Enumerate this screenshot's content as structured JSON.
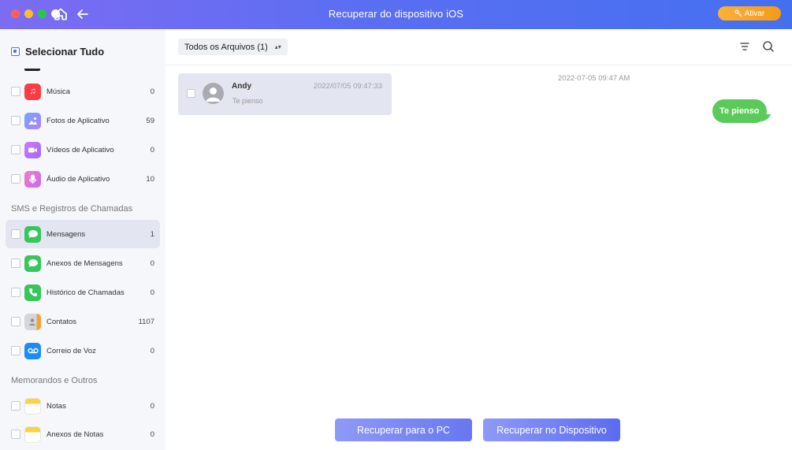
{
  "window": {
    "title": "Recuperar do dispositivo iOS",
    "activate_label": "Ativar",
    "traffic_colors": [
      "#ff5f57",
      "#ffbd2e",
      "#28c840",
      "#ffffff"
    ]
  },
  "sidebar": {
    "select_all": "Selecionar Tudo",
    "sections": [
      "SMS e Registros de Chamadas",
      "Memorandos e Outros"
    ],
    "items": [
      {
        "label": "Música",
        "count": "0",
        "icon": "music-icon",
        "color": "#fc3c44"
      },
      {
        "label": "Fotos de Aplicativo",
        "count": "59",
        "icon": "app-photos-icon",
        "color": "#8b7cf8"
      },
      {
        "label": "Vídeos de Aplicativo",
        "count": "0",
        "icon": "app-video-icon",
        "color": "#b470f5"
      },
      {
        "label": "Áudio de Aplicativo",
        "count": "10",
        "icon": "app-audio-icon",
        "color": "#ec5ab8"
      },
      {
        "label": "Mensagens",
        "count": "1",
        "icon": "messages-icon",
        "color": "#34c759"
      },
      {
        "label": "Anexos de Mensagens",
        "count": "0",
        "icon": "message-attachments-icon",
        "color": "#34c759"
      },
      {
        "label": "Histórico de Chamadas",
        "count": "0",
        "icon": "phone-icon",
        "color": "#34c759"
      },
      {
        "label": "Contatos",
        "count": "1107",
        "icon": "contacts-icon",
        "color": "#c9cbd0"
      },
      {
        "label": "Correio de Voz",
        "count": "0",
        "icon": "voicemail-icon",
        "color": "#1e8cf5"
      },
      {
        "label": "Notas",
        "count": "0",
        "icon": "notes-icon",
        "color": "#fcd33c"
      },
      {
        "label": "Anexos de Notas",
        "count": "0",
        "icon": "notes-attachments-icon",
        "color": "#fcd33c"
      }
    ]
  },
  "main": {
    "filter_label": "Todos os Arquivos (1)",
    "conversation": {
      "name": "Andy",
      "date": "2022/07/05 09:47:33",
      "preview": "Te pienso"
    },
    "thread": {
      "timestamp": "2022-07-05 09:47 AM",
      "message": "Te pienso"
    },
    "buttons": {
      "recover_pc": "Recuperar para o PC",
      "recover_device": "Recuperar no Dispositivo"
    }
  }
}
